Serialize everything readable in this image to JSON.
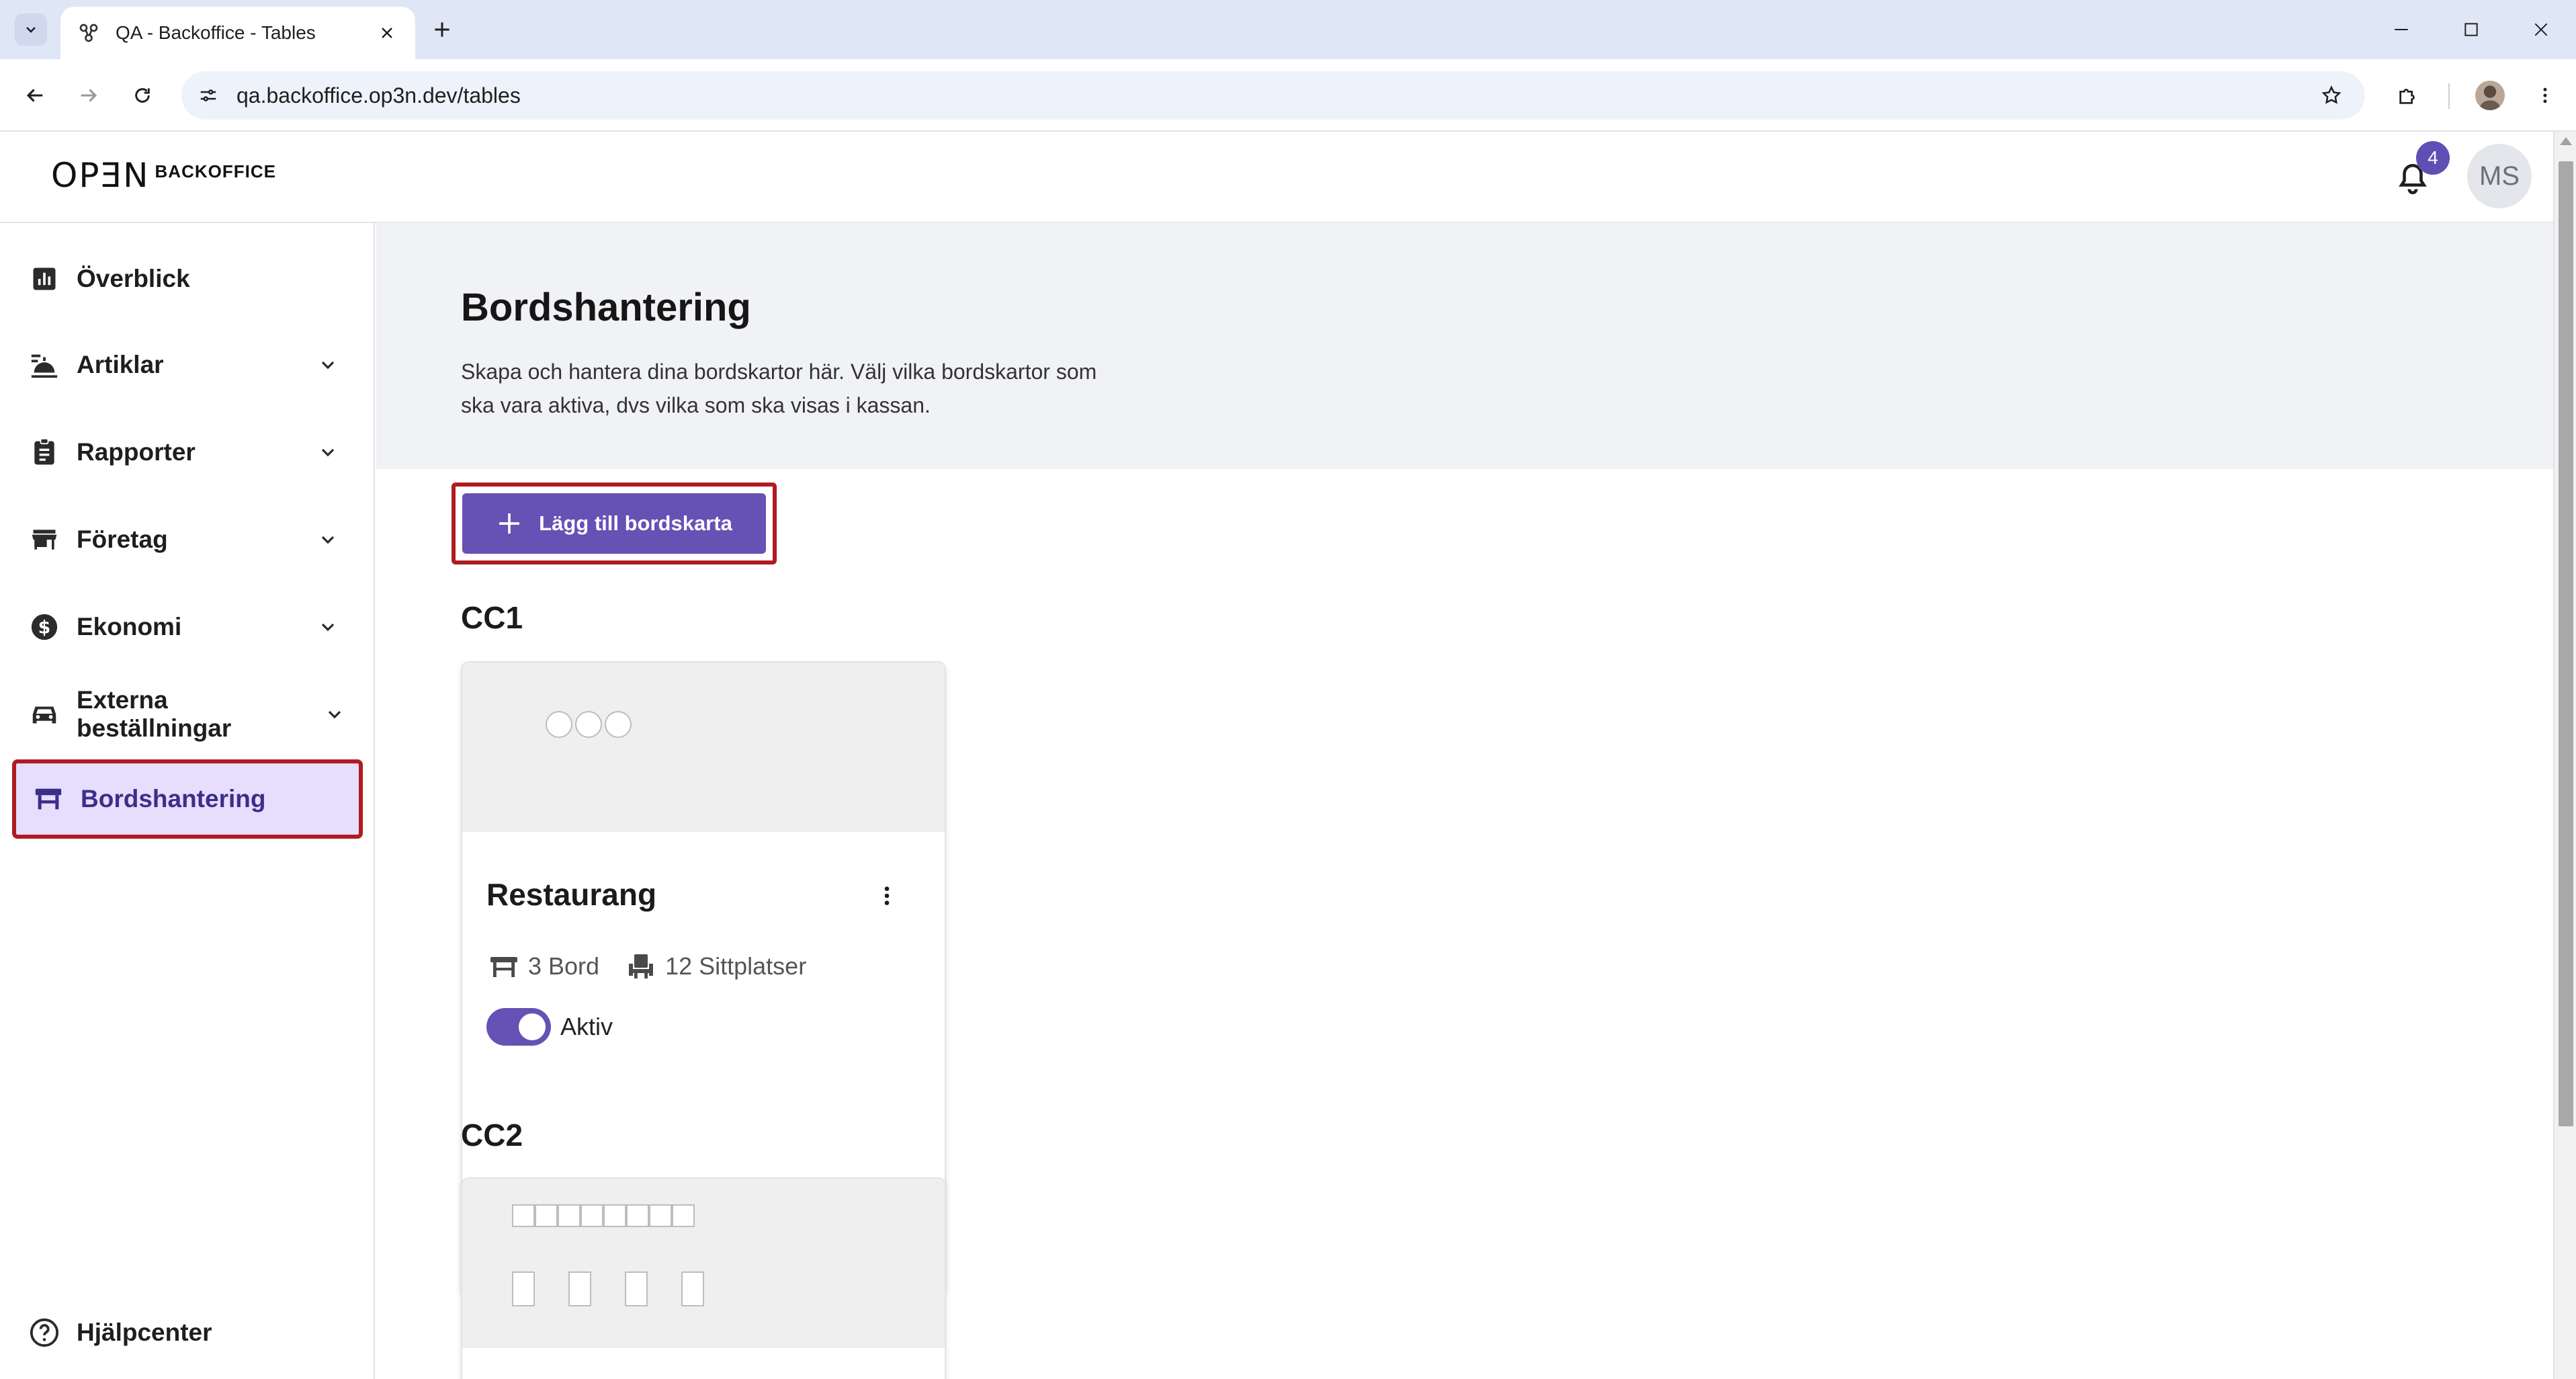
{
  "browser": {
    "tab_title": "QA - Backoffice - Tables",
    "url": "qa.backoffice.op3n.dev/tables"
  },
  "header": {
    "logo_mark": "OPƎN",
    "logo_text": "BACKOFFICE",
    "notification_count": "4",
    "avatar_initials": "MS"
  },
  "sidebar": {
    "items": [
      {
        "label": "Överblick",
        "icon": "bar-chart-icon",
        "expandable": false
      },
      {
        "label": "Artiklar",
        "icon": "food-icon",
        "expandable": true
      },
      {
        "label": "Rapporter",
        "icon": "clipboard-icon",
        "expandable": true
      },
      {
        "label": "Företag",
        "icon": "store-icon",
        "expandable": true
      },
      {
        "label": "Ekonomi",
        "icon": "dollar-icon",
        "expandable": true
      },
      {
        "label": "Externa beställningar",
        "icon": "car-icon",
        "expandable": true
      },
      {
        "label": "Bordshantering",
        "icon": "table-icon",
        "expandable": false,
        "active": true
      }
    ],
    "help": {
      "label": "Hjälpcenter",
      "icon": "help-icon"
    }
  },
  "main": {
    "title": "Bordshantering",
    "description": "Skapa och hantera dina bordskartor här. Välj vilka bordskartor som ska vara aktiva, dvs vilka som ska visas i kassan.",
    "add_button_label": "Lägg till bordskarta",
    "sections": [
      {
        "title": "CC1",
        "cards": [
          {
            "name": "Restaurang",
            "tables": "3 Bord",
            "seats": "12 Sittplatser",
            "status_label": "Aktiv",
            "active": true
          }
        ]
      },
      {
        "title": "CC2",
        "cards": []
      }
    ]
  },
  "colors": {
    "primary": "#6651b5",
    "highlight_border": "#b01b22",
    "active_nav_bg": "#e6defc",
    "hero_bg": "#f1f2f6"
  }
}
